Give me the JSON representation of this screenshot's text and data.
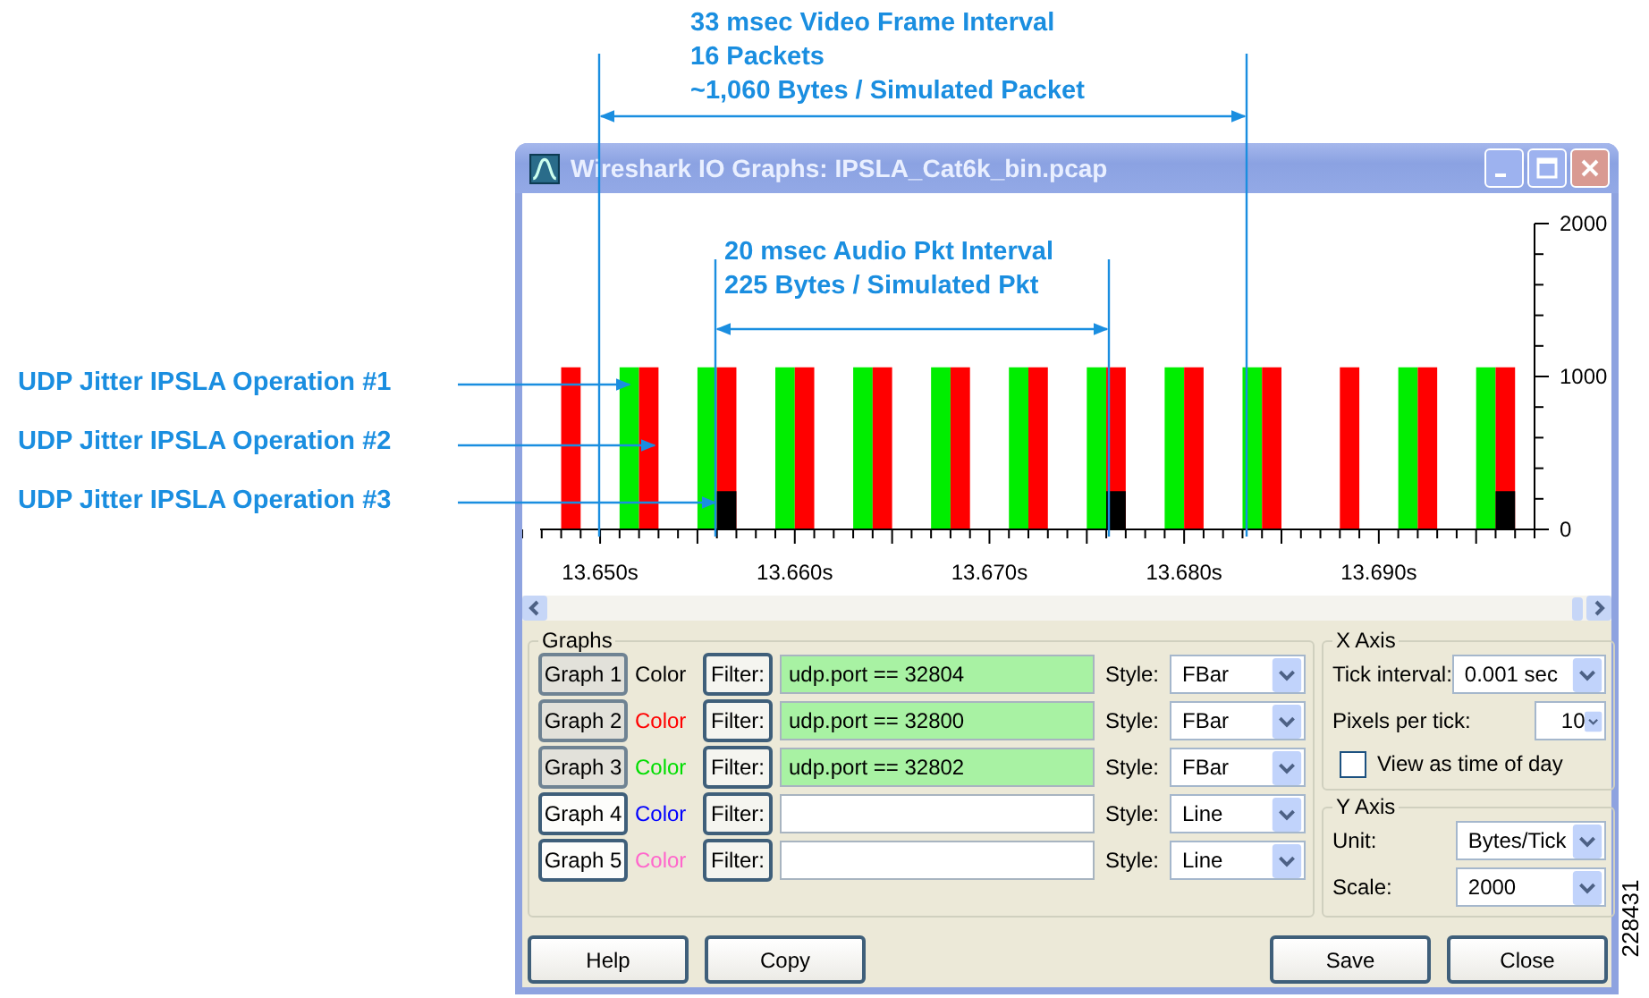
{
  "annotations": {
    "video_interval": [
      "33 msec Video Frame Interval",
      "16 Packets",
      "~1,060 Bytes / Simulated Packet"
    ],
    "audio_interval": [
      "20 msec Audio Pkt Interval",
      "225 Bytes /  Simulated Pkt"
    ],
    "operations": [
      "UDP Jitter IPSLA Operation #1",
      "UDP Jitter IPSLA Operation #2",
      "UDP Jitter IPSLA Operation #3"
    ],
    "figure_number": "228431"
  },
  "window": {
    "title": "Wireshark IO Graphs: IPSLA_Cat6k_bin.pcap",
    "chart_data": {
      "type": "bar",
      "x": [
        13.648,
        13.651,
        13.652,
        13.655,
        13.656,
        13.659,
        13.66,
        13.663,
        13.664,
        13.667,
        13.668,
        13.671,
        13.672,
        13.675,
        13.676,
        13.679,
        13.68,
        13.683,
        13.684,
        13.688,
        13.691,
        13.692,
        13.695,
        13.696
      ],
      "series": [
        {
          "color": "#000000",
          "values": [
            null,
            null,
            null,
            null,
            250,
            null,
            null,
            null,
            null,
            null,
            null,
            null,
            null,
            null,
            250,
            null,
            null,
            null,
            null,
            null,
            null,
            null,
            null,
            250
          ]
        },
        {
          "color": "#ff0000",
          "values": [
            1060,
            null,
            1060,
            null,
            1060,
            null,
            1060,
            null,
            1060,
            null,
            1060,
            null,
            1060,
            null,
            1060,
            null,
            1060,
            null,
            1060,
            1060,
            null,
            1060,
            null,
            1060
          ]
        },
        {
          "color": "#00ee00",
          "values": [
            null,
            1060,
            null,
            1060,
            null,
            1060,
            null,
            1060,
            null,
            1060,
            null,
            1060,
            null,
            1060,
            null,
            1060,
            null,
            1060,
            null,
            null,
            1060,
            null,
            1060,
            null
          ]
        }
      ],
      "xlim": [
        13.646,
        13.698
      ],
      "ylim": [
        0,
        2000
      ],
      "xticks": [
        {
          "value": 13.65,
          "label": "13.650s"
        },
        {
          "value": 13.66,
          "label": "13.660s"
        },
        {
          "value": 13.67,
          "label": "13.670s"
        },
        {
          "value": 13.68,
          "label": "13.680s"
        },
        {
          "value": 13.69,
          "label": "13.690s"
        }
      ],
      "yticks": [
        0,
        1000,
        2000
      ]
    },
    "graphs_title": "Graphs",
    "graphs": [
      {
        "button": "Graph 1",
        "active": true,
        "color_label": "Color",
        "color": "#000000",
        "filter_button": "Filter:",
        "filter": "udp.port == 32804",
        "style_label": "Style:",
        "style": "FBar"
      },
      {
        "button": "Graph 2",
        "active": true,
        "color_label": "Color",
        "color": "#ff0000",
        "filter_button": "Filter:",
        "filter": "udp.port == 32800",
        "style_label": "Style:",
        "style": "FBar"
      },
      {
        "button": "Graph 3",
        "active": true,
        "color_label": "Color",
        "color": "#00dd00",
        "filter_button": "Filter:",
        "filter": "udp.port == 32802",
        "style_label": "Style:",
        "style": "FBar"
      },
      {
        "button": "Graph 4",
        "active": false,
        "color_label": "Color",
        "color": "#0000ff",
        "filter_button": "Filter:",
        "style_label": "Style:",
        "style": "Line"
      },
      {
        "button": "Graph 5",
        "active": false,
        "color_label": "Color",
        "color": "#ff66cc",
        "filter_button": "Filter:",
        "style_label": "Style:",
        "style": "Line"
      }
    ],
    "x_axis": {
      "title": "X Axis",
      "tick_interval_label": "Tick interval:",
      "tick_interval": "0.001 sec",
      "pixels_per_tick_label": "Pixels per tick:",
      "pixels_per_tick": "10",
      "view_as_time_of_day": {
        "label": "View as time of day",
        "checked": false
      }
    },
    "y_axis": {
      "title": "Y Axis",
      "unit_label": "Unit:",
      "unit": "Bytes/Tick",
      "scale_label": "Scale:",
      "scale": "2000"
    },
    "buttons": [
      "Help",
      "Copy",
      "Save",
      "Close"
    ]
  }
}
